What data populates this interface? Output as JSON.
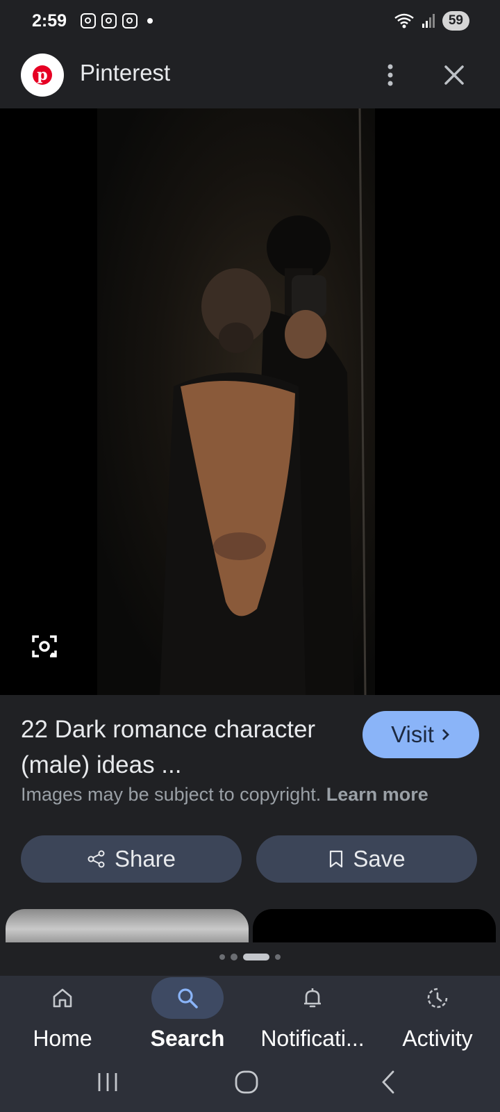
{
  "status_bar": {
    "time": "2:59",
    "notification_icons": [
      "instagram-icon",
      "instagram-icon",
      "instagram-icon"
    ],
    "battery": "59"
  },
  "header": {
    "app_name": "Pinterest",
    "logo_letter": "p",
    "brand_color": "#e60023"
  },
  "result": {
    "title": "22 Dark romance character (male) ideas ...",
    "visit_label": "Visit",
    "copyright_text": "Images may be subject to copyright.",
    "learn_more_label": "Learn more",
    "share_label": "Share",
    "save_label": "Save",
    "accent_color": "#8ab4f8"
  },
  "bottom_nav": {
    "items": [
      {
        "label": "Home",
        "icon": "home-icon",
        "active": false
      },
      {
        "label": "Search",
        "icon": "search-icon",
        "active": true
      },
      {
        "label": "Notificati...",
        "icon": "bell-icon",
        "active": false
      },
      {
        "label": "Activity",
        "icon": "activity-icon",
        "active": false
      }
    ]
  },
  "pager": {
    "pages": 4,
    "current_page": 3
  }
}
